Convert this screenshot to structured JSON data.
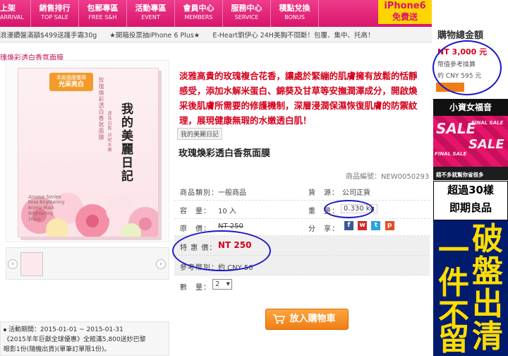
{
  "nav": {
    "items": [
      {
        "zh": "上架",
        "en": "ARRIVAL"
      },
      {
        "zh": "銷售排行",
        "en": "TOP SALE"
      },
      {
        "zh": "包郵專區",
        "en": "FREE S&H"
      },
      {
        "zh": "活動專區",
        "en": "EVENT"
      },
      {
        "zh": "會員中心",
        "en": "MEMBERS"
      },
      {
        "zh": "服務中心",
        "en": "SERVICE"
      },
      {
        "zh": "積點兌換",
        "en": "BONUS"
      }
    ],
    "promo_line1": "iPhone6",
    "promo_line2": "免費送"
  },
  "ticker": {
    "items": [
      "浪漫鑽盤滿額$499送護手霜30g",
      "★開箱投票抽iPhone 6 Plus★",
      "E-Heart劉伊心 24H美胸不間斷！包覆、集中、托高！"
    ]
  },
  "breadcrumb": "瑰煥彩透白香氛面膜",
  "product_box": {
    "badge_top": "光采亮白",
    "badge_small": "本款面膜獲得",
    "brand_vertical": "我的美麗日記",
    "side_text": "玫瑰煥彩透白香氛面膜",
    "side_text2": "透亮白皙 淡斑水嫩",
    "mini_en": [
      "Aroma Series",
      "Rose Brightening",
      "Aroma Mask",
      "Brightening",
      "10pcs"
    ]
  },
  "description": "淡雅高貴的玫瑰複合花香，讓處於緊繃的肌膚擁有放鬆的恬靜感受，添加水解米蛋白、錦葵及甘草等安撫潤澤成分，開啟煥采後肌膚所需要的修護機制，深層浸潤保濕恢復肌膚的防禦紋理，展現健康無瑕的水嫩透白肌！",
  "brand_tag": "我的美麗日記",
  "product_title": "玫瑰煥彩透白香氛面膜",
  "sku": "商品編號：NEW0050293",
  "info": {
    "category_label": "商品類別：",
    "category_value": "一般商品",
    "source_label": "貨　源：",
    "source_value": "公司正貨",
    "capacity_label": "容　量：",
    "capacity_value": "10 入",
    "weight_label": "重　量：",
    "weight_value": "0.330 kg",
    "orig_label": "原　價：",
    "orig_value": "NT 250",
    "share_label": "分　享：",
    "special_label": "特 惠 價：",
    "special_value": "NT 250",
    "ref_label": "參考幣別：",
    "ref_value": "約 CNY 50",
    "qty_label": "數　量：",
    "qty_value": "2"
  },
  "cart_button": "放入購物車",
  "promo_box": {
    "line1": "活動期間：2015-01-01 ~ 2015-01-31",
    "line2": "《2015羊年巨獻全球優惠》全館滿5,800送妙巴黎",
    "line3": "眼影1份(隨機出貨)(單筆訂單限1份)。"
  },
  "cart_panel": {
    "title": "購物總金額",
    "total": "NT 3,000 元",
    "note": "幣值參考換算",
    "cny": "約 CNY 595 元"
  },
  "ads": {
    "ad1_head": "小資女福音",
    "ad1_sale": "SALE",
    "ad1_final": "FINAL SALE",
    "ad1_foot": "錯不多就幫你省很多",
    "ad2_line1": "超過30樣",
    "ad2_line2": "即期良品",
    "ad3_chars": [
      "破",
      "盤",
      "出",
      "清",
      "一",
      "件",
      "不",
      "留"
    ]
  },
  "colors": {
    "brand_pink": "#d8156c",
    "price_red": "#d6001c",
    "annotation_blue": "#1c16c8",
    "cart_orange": "#f07d14"
  }
}
